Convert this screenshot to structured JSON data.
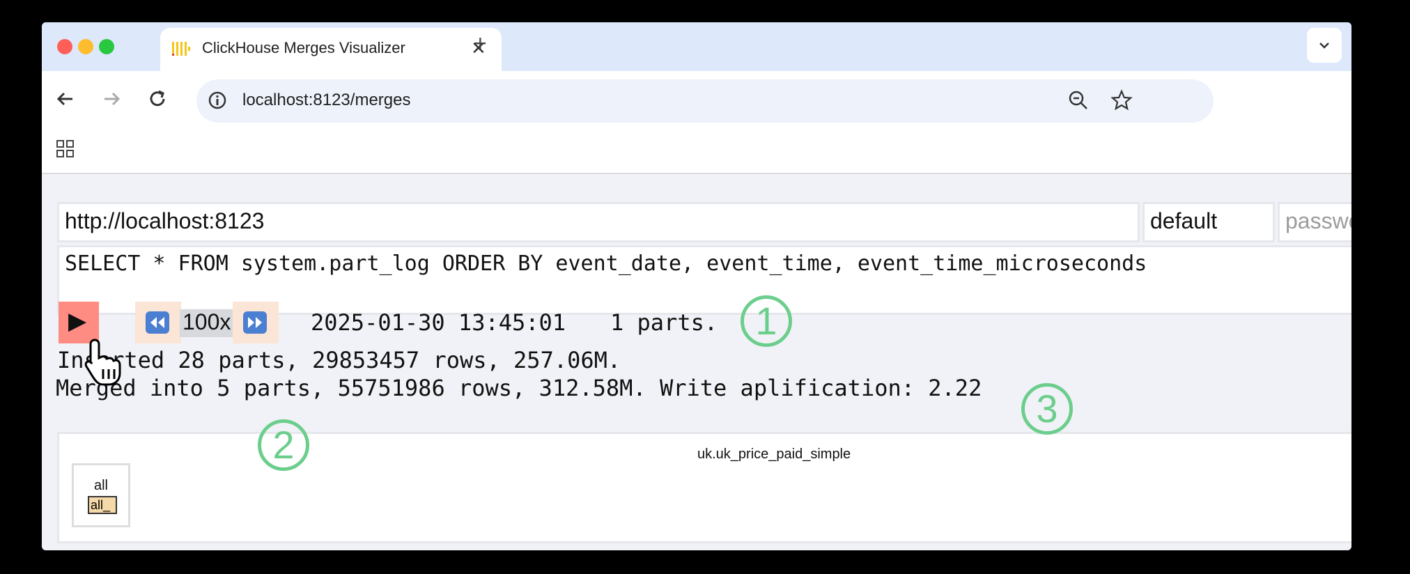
{
  "browser": {
    "tab_title": "ClickHouse Merges Visualizer",
    "tab_close": "✕",
    "new_tab": "+",
    "tabs_menu": "⌄",
    "url": "localhost:8123/merges"
  },
  "form": {
    "host": "http://localhost:8123",
    "user": "default",
    "password_placeholder": "password",
    "query": "SELECT * FROM system.part_log ORDER BY event_date, event_time, event_time_microseconds"
  },
  "player": {
    "play_icon": "▶",
    "speed": "100x",
    "timestamp": "2025-01-30 13:45:01",
    "parts": "1 parts."
  },
  "stats": {
    "inserted": "Inserted 28 parts, 29853457 rows, 257.06M.",
    "merged": "Merged into 5 parts, 55751986 rows, 312.58M. Write aplification: 2.22"
  },
  "visualization": {
    "table_name": "uk.uk_price_paid_simple",
    "partition_label": "all",
    "part_label": "all_"
  },
  "annotations": [
    "1",
    "2",
    "3"
  ]
}
